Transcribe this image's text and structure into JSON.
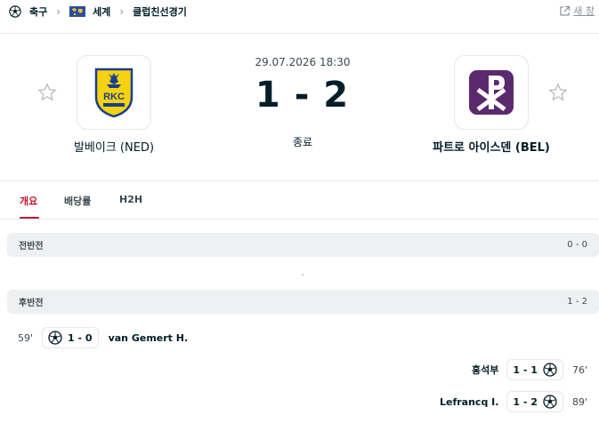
{
  "breadcrumb": {
    "sport": "축구",
    "region": "세계",
    "competition": "클럽친선경기"
  },
  "new_window_label": "새 창",
  "match": {
    "date": "29.07.2026 18:30",
    "home_score": "1",
    "separator": "-",
    "away_score": "2",
    "status": "종료",
    "home_team": "발베이크 (NED)",
    "away_team": "파트로 아이스덴 (BEL)",
    "home_logo_text": "RKC"
  },
  "tabs": [
    {
      "label": "개요",
      "active": true
    },
    {
      "label": "배당률",
      "active": false
    },
    {
      "label": "H2H",
      "active": false
    }
  ],
  "periods": [
    {
      "label": "전반전",
      "score": "0 - 0"
    },
    {
      "label": "후반전",
      "score": "1 - 2"
    }
  ],
  "first_half_empty": "-",
  "incidents": [
    {
      "side": "home",
      "minute": "59'",
      "score": "1 - 0",
      "player": "van Gemert H.",
      "icon": "soccer-ball-icon"
    },
    {
      "side": "away",
      "minute": "76'",
      "score": "1 - 1",
      "player": "홍석부",
      "icon": "soccer-ball-icon"
    },
    {
      "side": "away",
      "minute": "89'",
      "score": "1 - 2",
      "player": "Lefrancq I.",
      "icon": "soccer-ball-icon"
    }
  ],
  "colors": {
    "accent": "#c8102e",
    "text": "#001e28",
    "muted": "#8a9499",
    "period_bg": "#eef0f1",
    "home_logo_yellow": "#f5d20f",
    "home_logo_blue": "#1a3d8f",
    "away_logo_purple": "#5b2a6e"
  }
}
